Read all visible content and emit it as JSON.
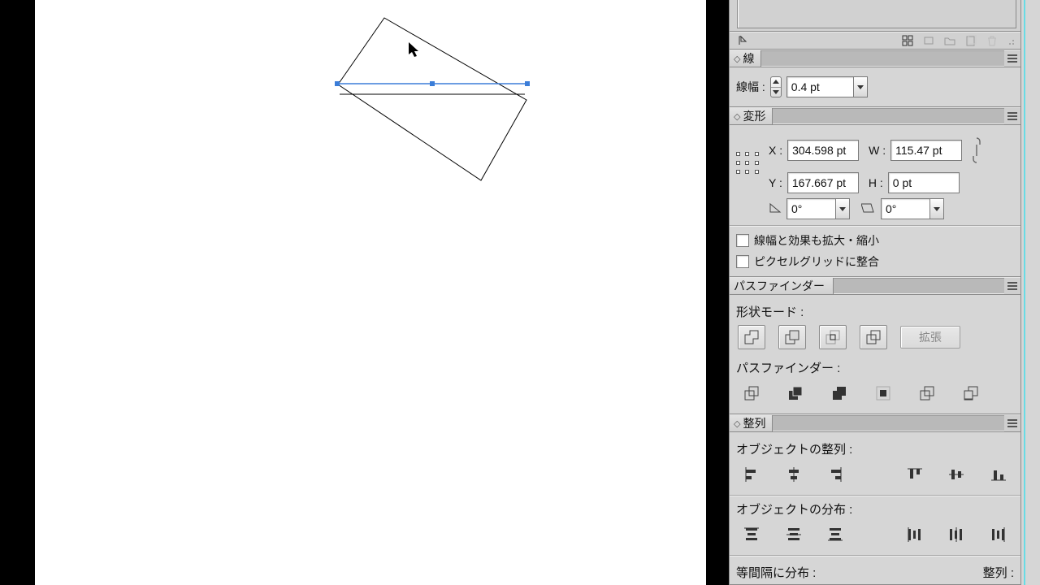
{
  "panels": {
    "stroke": {
      "title": "線",
      "weight_label": "線幅 :",
      "weight_value": "0.4 pt"
    },
    "transform": {
      "title": "変形",
      "x_label": "X :",
      "x_value": "304.598 pt",
      "y_label": "Y :",
      "y_value": "167.667 pt",
      "w_label": "W :",
      "w_value": "115.47 pt",
      "h_label": "H :",
      "h_value": "0 pt",
      "rotate_value": "0°",
      "shear_value": "0°",
      "scale_strokes_label": "線幅と効果も拡大・縮小",
      "pixel_grid_label": "ピクセルグリッドに整合"
    },
    "pathfinder": {
      "title": "パスファインダー",
      "shape_modes_label": "形状モード :",
      "expand_label": "拡張",
      "pathfinders_label": "パスファインダー :"
    },
    "align": {
      "title": "整列",
      "align_objects_label": "オブジェクトの整列 :",
      "distribute_objects_label": "オブジェクトの分布 :",
      "distribute_spacing_label": "等間隔に分布 :",
      "align_to_label": "整列 :"
    }
  }
}
